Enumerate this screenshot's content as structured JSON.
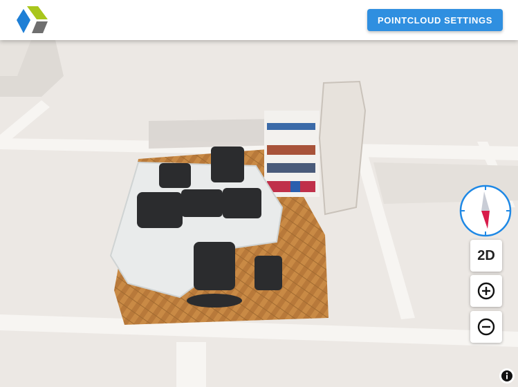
{
  "header": {
    "logo_icon": "cube-logo-icon",
    "settings_label": "POINTCLOUD SETTINGS"
  },
  "controls": {
    "compass_icon": "compass-icon",
    "view_toggle_label": "2D",
    "zoom_in_icon": "plus-circle-icon",
    "zoom_out_icon": "minus-circle-icon"
  },
  "attribution": {
    "icon": "info-icon"
  },
  "colors": {
    "accent": "#2f8fe0",
    "compass_ring": "#1e88e5",
    "compass_north": "#d81b4a",
    "map_background": "#ece8e4",
    "road": "#f7f5f2",
    "floor_wood": "#b8793a",
    "desk": "#e9ebeb"
  }
}
